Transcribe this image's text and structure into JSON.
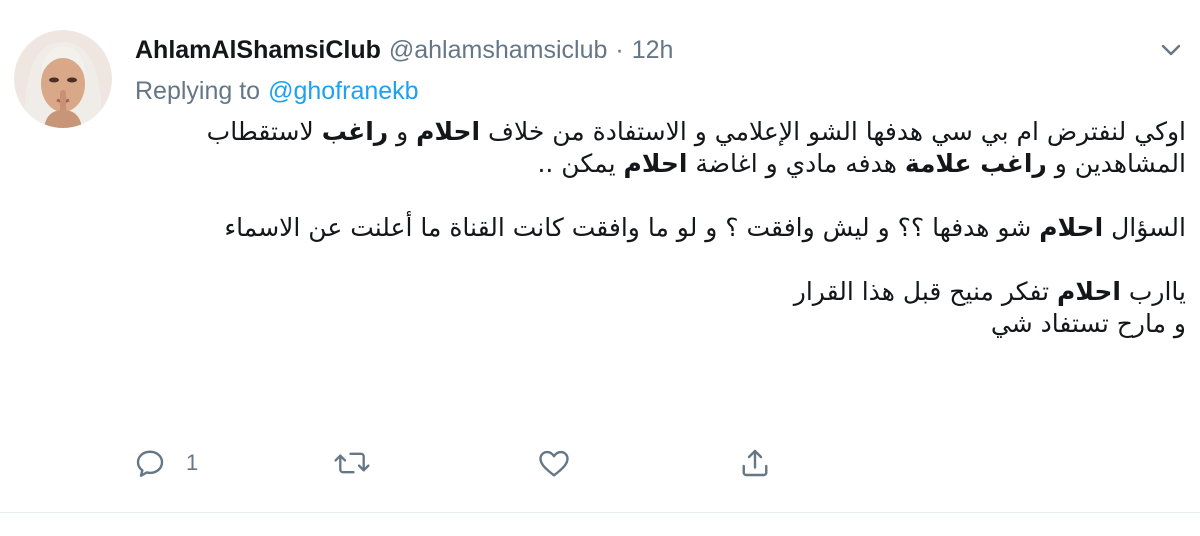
{
  "tweet": {
    "display_name": "AhlamAlShamsiClub",
    "handle": "@ahlamshamsiclub",
    "separator": "·",
    "time": "12h",
    "replying_prefix": "Replying to",
    "replying_to": "@ghofranekb",
    "paragraphs": [
      [
        {
          "text": "اوكي لنفترض ام بي سي هدفها الشو الإعلامي و الاستفادة من خلاف ",
          "bold": false
        },
        {
          "text": "احلام",
          "bold": true
        },
        {
          "text": " و ",
          "bold": false
        },
        {
          "text": "راغب",
          "bold": true
        },
        {
          "text": " لاستقطاب المشاهدين و ",
          "bold": false
        },
        {
          "text": "راغب علامة",
          "bold": true
        },
        {
          "text": " هدفه مادي و اغاضة ",
          "bold": false
        },
        {
          "text": "احلام",
          "bold": true
        },
        {
          "text": " يمكن ..",
          "bold": false
        }
      ],
      [
        {
          "text": "السؤال ",
          "bold": false
        },
        {
          "text": "احلام",
          "bold": true
        },
        {
          "text": " شو هدفها ؟؟ و ليش وافقت ؟ و لو ما وافقت كانت القناة ما أعلنت عن الاسماء",
          "bold": false
        }
      ],
      [
        {
          "text": "ياارب ",
          "bold": false
        },
        {
          "text": "احلام",
          "bold": true
        },
        {
          "text": " تفكر منيح قبل هذا القرار",
          "bold": false
        },
        {
          "text": "\n",
          "bold": false
        },
        {
          "text": "و مارح تستفاد شي",
          "bold": false
        }
      ]
    ],
    "actions": {
      "reply_count": "1",
      "retweet_count": "",
      "like_count": ""
    },
    "icons": {
      "reply": "reply-icon",
      "retweet": "retweet-icon",
      "like": "heart-icon",
      "share": "share-icon",
      "more": "chevron-down-icon"
    },
    "colors": {
      "text": "#14171a",
      "secondary": "#657786",
      "link": "#1da1f2",
      "divider": "#e6ecf0"
    }
  }
}
